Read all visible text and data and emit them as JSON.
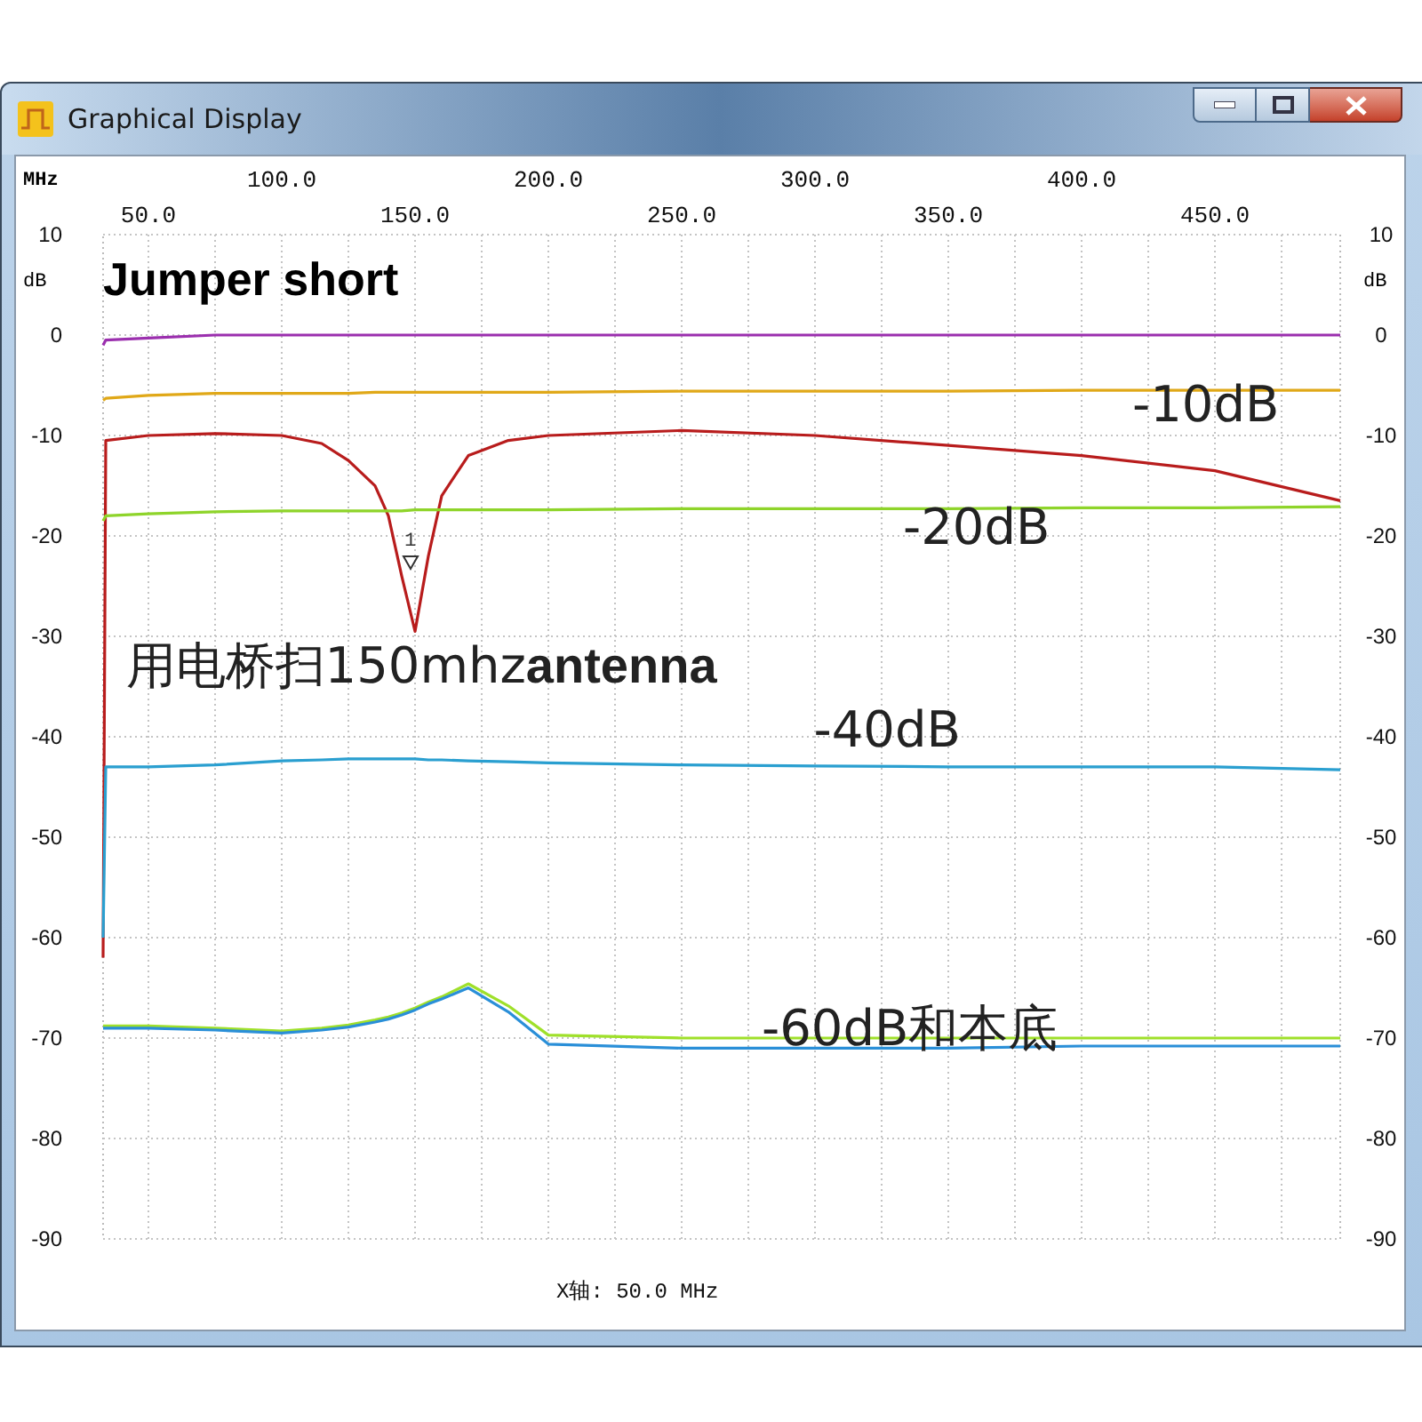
{
  "window": {
    "title": "Graphical Display"
  },
  "chart": {
    "x_unit": "MHz",
    "y_unit_left": "dB",
    "y_unit_right": "dB",
    "upper_xtick_labels": [
      "100.0",
      "200.0",
      "300.0",
      "400.0"
    ],
    "left_ytick_labels": [
      "10",
      "0",
      "-10",
      "-20",
      "-30",
      "-40",
      "-50",
      "-60",
      "-70",
      "-80",
      "-90"
    ],
    "chart_data": {
      "type": "line",
      "grid": true,
      "xlim": [
        33,
        497
      ],
      "ylim": [
        -90,
        10
      ],
      "x": [
        33,
        34,
        50,
        75,
        100,
        115,
        125,
        135,
        140,
        145,
        150,
        155,
        160,
        170,
        185,
        200,
        250,
        300,
        350,
        400,
        450,
        497
      ],
      "xticks": [
        {
          "value": 50,
          "label": "50.0"
        },
        {
          "value": 150,
          "label": "150.0"
        },
        {
          "value": 250,
          "label": "250.0"
        },
        {
          "value": 350,
          "label": "350.0"
        },
        {
          "value": 450,
          "label": "450.0"
        }
      ],
      "yticks": [
        10,
        0,
        -10,
        -20,
        -30,
        -40,
        -50,
        -60,
        -70,
        -80,
        -90
      ],
      "series": [
        {
          "color": "#9b2fae",
          "values": [
            -1,
            -0.5,
            -0.3,
            0,
            0,
            0,
            0,
            0,
            0,
            0,
            0,
            0,
            0,
            0,
            0,
            0,
            0,
            0,
            0,
            0,
            0,
            0
          ]
        },
        {
          "color": "#e0a818",
          "values": [
            -6.5,
            -6.3,
            -6,
            -5.8,
            -5.8,
            -5.8,
            -5.8,
            -5.7,
            -5.7,
            -5.7,
            -5.7,
            -5.7,
            -5.7,
            -5.7,
            -5.7,
            -5.7,
            -5.6,
            -5.6,
            -5.6,
            -5.5,
            -5.5,
            -5.5
          ]
        },
        {
          "color": "#b81c1c",
          "values": [
            -62,
            -10.5,
            -10,
            -9.8,
            -10,
            -10.8,
            -12.5,
            -15,
            -18,
            -24,
            -29.5,
            -22,
            -16,
            -12,
            -10.5,
            -10,
            -9.5,
            -10,
            -11,
            -12,
            -13.5,
            -16.5
          ]
        },
        {
          "color": "#8ed42a",
          "values": [
            -18.5,
            -18,
            -17.8,
            -17.6,
            -17.5,
            -17.5,
            -17.5,
            -17.5,
            -17.5,
            -17.5,
            -17.4,
            -17.4,
            -17.4,
            -17.4,
            -17.4,
            -17.4,
            -17.3,
            -17.3,
            -17.3,
            -17.2,
            -17.2,
            -17.1
          ]
        },
        {
          "color": "#2a9fd0",
          "values": [
            -60,
            -43,
            -43,
            -42.8,
            -42.4,
            -42.3,
            -42.2,
            -42.2,
            -42.2,
            -42.2,
            -42.2,
            -42.3,
            -42.3,
            -42.4,
            -42.5,
            -42.6,
            -42.8,
            -42.9,
            -43,
            -43,
            -43,
            -43.3
          ]
        },
        {
          "color": "#9fe02a",
          "values": [
            -68.8,
            -68.8,
            -68.8,
            -69,
            -69.3,
            -69,
            -68.7,
            -68.2,
            -67.9,
            -67.5,
            -67,
            -66.4,
            -65.9,
            -64.6,
            -66.8,
            -69.7,
            -70,
            -70,
            -70,
            -70,
            -70,
            -70
          ]
        },
        {
          "color": "#2a8fd8",
          "values": [
            -69,
            -69,
            -69,
            -69.2,
            -69.5,
            -69.2,
            -68.9,
            -68.4,
            -68.1,
            -67.7,
            -67.2,
            -66.6,
            -66.1,
            -65,
            -67.4,
            -70.6,
            -71,
            -71,
            -71,
            -70.8,
            -70.8,
            -70.8
          ]
        }
      ]
    },
    "labels": [
      {
        "kind": "title",
        "text": "Jumper short"
      },
      {
        "kind": "label",
        "text": "-10dB"
      },
      {
        "kind": "label",
        "text": "-20dB"
      },
      {
        "kind": "label",
        "text": "用电桥扫150mhz**antenna**"
      },
      {
        "kind": "label",
        "text": "-40dB"
      },
      {
        "kind": "label",
        "text": "-60dB和本底"
      },
      {
        "kind": "marker",
        "text": "1"
      }
    ]
  },
  "status_bar": {
    "text": "X轴: 50.0 MHz"
  }
}
